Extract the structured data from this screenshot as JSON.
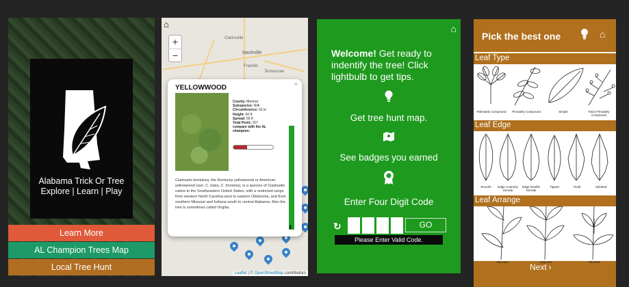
{
  "panel1": {
    "app_title": "Alabama Trick Or Tree",
    "tagline": "Explore | Learn | Play",
    "buttons": {
      "learn_more": "Learn More",
      "champion_map": "AL Champion Trees Map",
      "local_hunt": "Local Tree Hunt"
    },
    "colors": {
      "learn_more": "#e05a3a",
      "champion_map": "#1d9a67",
      "local_hunt": "#b16d22"
    }
  },
  "panel2": {
    "map_labels": {
      "clarksville": "Clarksville",
      "nashville": "Nashville",
      "tennessee": "Tennessee",
      "franklin": "Franklin"
    },
    "zoom_in": "+",
    "zoom_out": "−",
    "popup": {
      "title": "YELLOWWOOD",
      "close": "×",
      "county_label": "County:",
      "county_value": "Monroe",
      "subspecies_label": "Subspecies:",
      "subspecies_value": "N/A",
      "circumference_label": "Circumference:",
      "circumference_value": "62 in",
      "height_label": "Height:",
      "height_value": "60 ft",
      "spread_label": "Spread:",
      "spread_value": "59 ft",
      "total_point_label": "Total Point:",
      "total_point_value": "157",
      "compare_label": "compare with the AL champion:",
      "compare_fraction": 0.35,
      "description": "Cladrastis kentukea, the Kentucky yellowwood or American yellowwood (syn. C. lutea, C. tinctoria), is a species of Cladrastis native to the Southeastern United States, with a restricted range from western North Carolina west to eastern Oklahoma, and from southern Missouri and Indiana south to central Alabama. Also the tree is sometimes called Virgilia."
    },
    "attribution": {
      "leaflet": "Leaflet",
      "sep": " | © ",
      "osm": "OpenStreetMap",
      "contrib": " contributors"
    }
  },
  "panel3": {
    "welcome_bold": "Welcome!",
    "welcome_rest": " Get ready to indentify the tree! Click lightbulb to get tips.",
    "menu": {
      "map": "Get tree hunt map.",
      "badges": "See badges you earned",
      "code": "Enter Four Digit Code"
    },
    "go_label": "GO",
    "error": "Please Enter Valid Code.",
    "bg_color": "#1e9a1e"
  },
  "panel4": {
    "title": "Pick the best one",
    "sections": {
      "type": "Leaf Type",
      "edge": "Leaf Edge",
      "arrange": "Leaf Arrange"
    },
    "type_captions": [
      "Palmately Compound",
      "Pinnately Compound",
      "Simple",
      "Twice Pinnately Compound"
    ],
    "edge_captions": [
      "Smooth",
      "Edge Coarsely Serrate",
      "Edge Double Serrate",
      "Tipped",
      "Tooth",
      "Unlobed"
    ],
    "arrange_captions": [
      "Alternate",
      "Opposite",
      "Whorled"
    ],
    "next": "Next",
    "header_color": "#b0701e"
  }
}
